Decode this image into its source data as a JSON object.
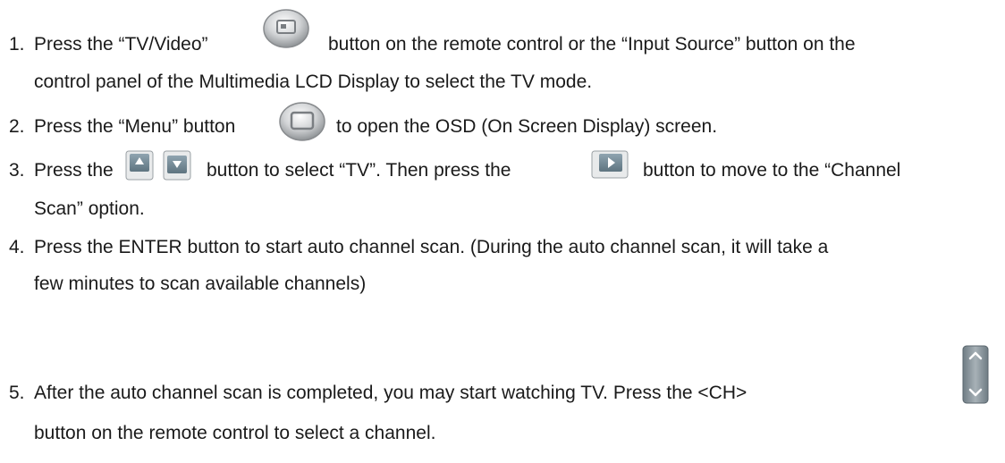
{
  "steps": [
    {
      "number": "1.",
      "line1": {
        "a": "Press the “TV/Video”",
        "b": "button on the remote control or the “Input Source” button on the"
      },
      "line2": "control panel of the Multimedia LCD Display to select the TV mode."
    },
    {
      "number": "2.",
      "line1": {
        "a": "Press the “Menu” button",
        "b": "to open the OSD (On Screen Display) screen."
      }
    },
    {
      "number": "3.",
      "line1": {
        "a": "Press the",
        "b": "button to select “TV”. Then press the",
        "c": "button to move to the “Channel"
      },
      "line2": "Scan” option."
    },
    {
      "number": "4.",
      "line1": "Press the ENTER button to start auto channel scan. (During the auto channel scan, it will take a",
      "line2": "few minutes to scan available channels)"
    },
    {
      "number": "5.",
      "line1": "After the auto channel scan is completed, you may start watching TV.  Press the <CH>",
      "line2": "button on the remote control to select a channel."
    }
  ],
  "icons": [
    "tv-video-button-icon",
    "menu-button-icon",
    "up-arrow-button-icon",
    "down-arrow-button-icon",
    "right-arrow-button-icon",
    "channel-up-down-button-icon"
  ]
}
